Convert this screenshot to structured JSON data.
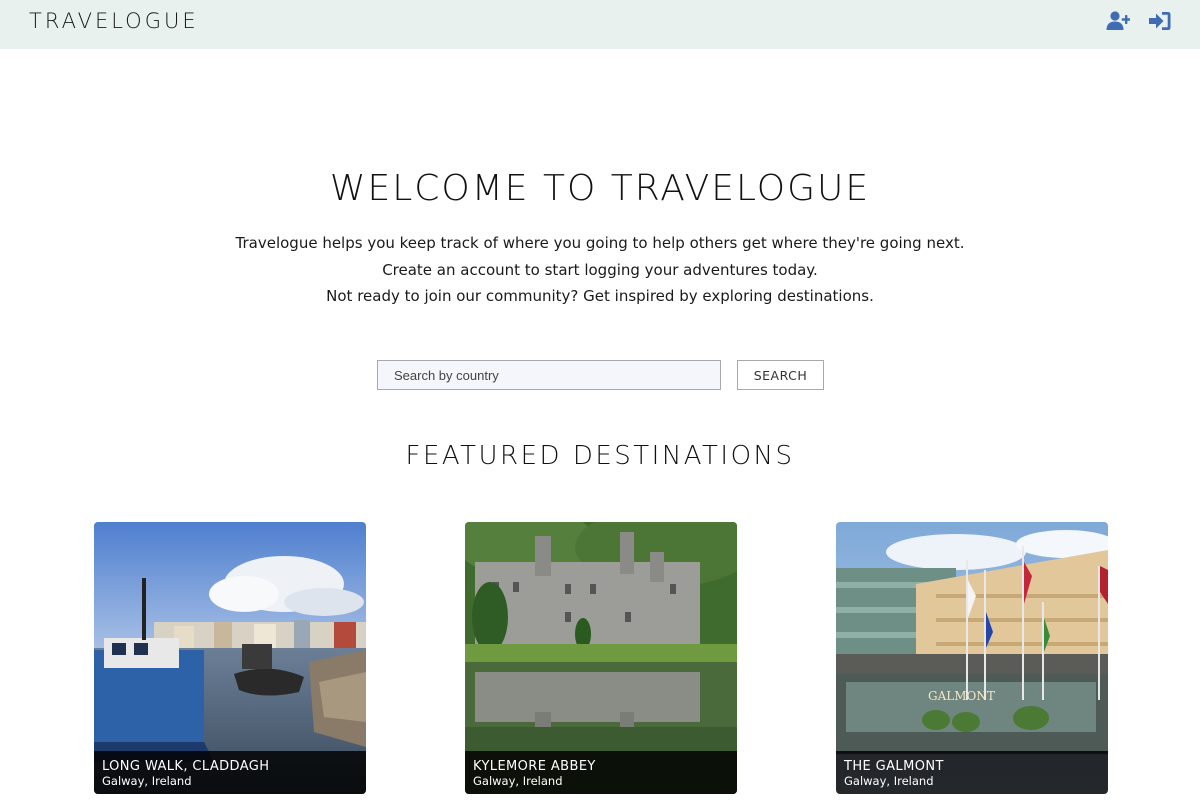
{
  "brand": {
    "name": "TRAVELOGUE",
    "accent_color": "#3f6cb2",
    "nav_bg": "#e8f1ee"
  },
  "nav": {
    "icons": [
      {
        "icon": "user-plus-icon"
      },
      {
        "icon": "sign-in-icon"
      }
    ]
  },
  "hero": {
    "title": "WELCOME TO TRAVELOGUE",
    "lines": [
      "Travelogue helps you keep track of where you going to help others get where they're going next.",
      "Create an account to start logging your adventures today.",
      "Not ready to join our community? Get inspired by exploring destinations."
    ]
  },
  "search": {
    "placeholder": "Search by country",
    "button_label": "SEARCH"
  },
  "featured": {
    "title": "FEATURED DESTINATIONS",
    "cards": [
      {
        "title": "LONG WALK, CLADDAGH",
        "location": "Galway, Ireland"
      },
      {
        "title": "KYLEMORE ABBEY",
        "location": "Galway, Ireland"
      },
      {
        "title": "THE GALMONT",
        "location": "Galway, Ireland",
        "sign_text": "GALMONT"
      }
    ]
  }
}
